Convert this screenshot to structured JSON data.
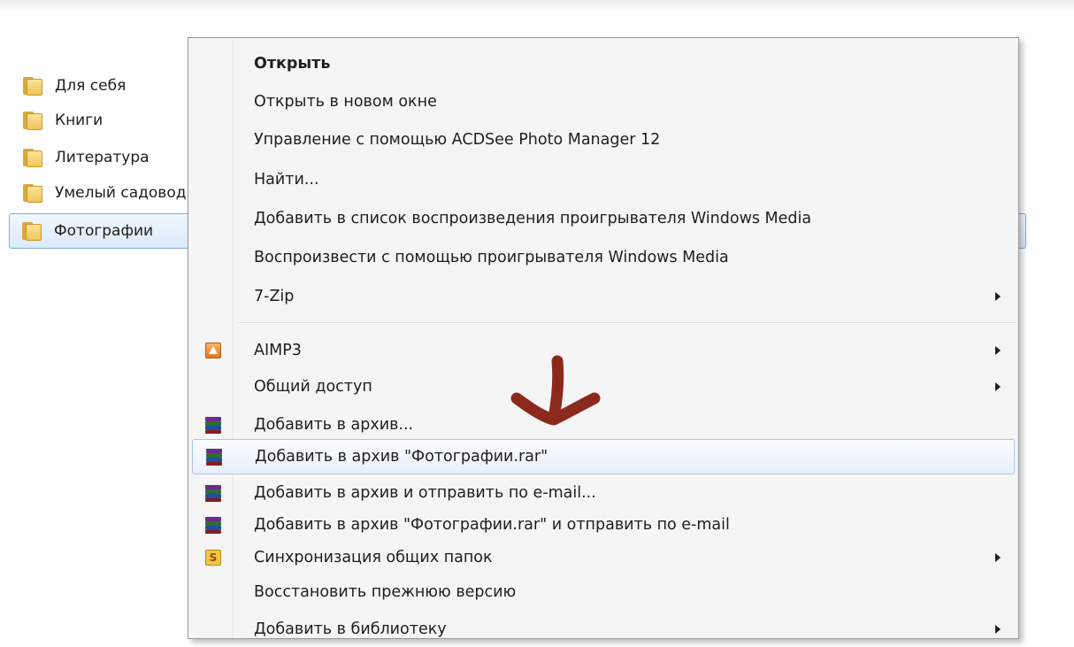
{
  "explorer": {
    "folders": [
      {
        "label": "Для себя",
        "icon": "folder-icon"
      },
      {
        "label": "Книги",
        "icon": "folder-icon"
      },
      {
        "label": "Литература",
        "icon": "folder-icon"
      },
      {
        "label": "Умелый садовод",
        "icon": "folder-icon"
      },
      {
        "label": "Фотографии",
        "icon": "folder-icon",
        "selected": true
      }
    ]
  },
  "context_menu": {
    "items": [
      {
        "label": "Открыть",
        "bold": true
      },
      {
        "label": "Открыть в новом окне"
      },
      {
        "label": "Управление с помощью ACDSee Photo Manager 12"
      },
      {
        "label": "Найти..."
      },
      {
        "label": "Добавить в список воспроизведения проигрывателя Windows Media"
      },
      {
        "label": "Воспроизвести с помощью проигрывателя Windows Media"
      },
      {
        "label": "7-Zip",
        "submenu": true
      },
      {
        "label": "AIMP3",
        "icon": "aimp-icon",
        "submenu": true
      },
      {
        "label": "Общий доступ",
        "submenu": true
      },
      {
        "label": "Добавить в архив...",
        "icon": "winrar-icon"
      },
      {
        "label": "Добавить в архив \"Фотографии.rar\"",
        "icon": "winrar-icon",
        "highlighted": true
      },
      {
        "label": "Добавить в архив и отправить по e-mail...",
        "icon": "winrar-icon"
      },
      {
        "label": "Добавить в архив \"Фотографии.rar\" и отправить по e-mail",
        "icon": "winrar-icon"
      },
      {
        "label": "Синхронизация общих папок",
        "icon": "sync-icon",
        "submenu": true
      },
      {
        "label": "Восстановить прежнюю версию"
      },
      {
        "label": "Добавить в библиотеку",
        "submenu": true,
        "partially_visible": true
      }
    ],
    "sync_icon_glyph": "S"
  },
  "colors": {
    "annotation_arrow": "#8b2a1c",
    "selection_border": "#84acdd",
    "menu_background": "#f5f5f5"
  }
}
